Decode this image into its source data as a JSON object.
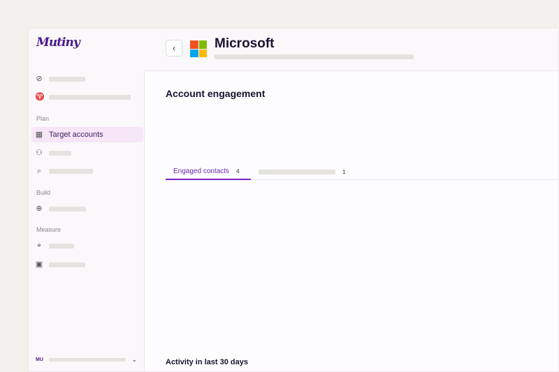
{
  "sidebar": {
    "logo": "Mutiny",
    "sections": {
      "plan": "Plan",
      "build": "Build",
      "measure": "Measure"
    },
    "active_item": "Target accounts",
    "user_initials": "MU"
  },
  "header": {
    "back_label": "‹",
    "company": "Microsoft"
  },
  "main": {
    "section_title": "Account engagement",
    "tabs": [
      {
        "label": "Engaged contacts",
        "count": "4"
      },
      {
        "count": "1"
      }
    ],
    "activity_title": "Activity in last 30 days"
  },
  "colors": {
    "accent": "#7b22c4",
    "active_bg": "#f7e5f8"
  }
}
